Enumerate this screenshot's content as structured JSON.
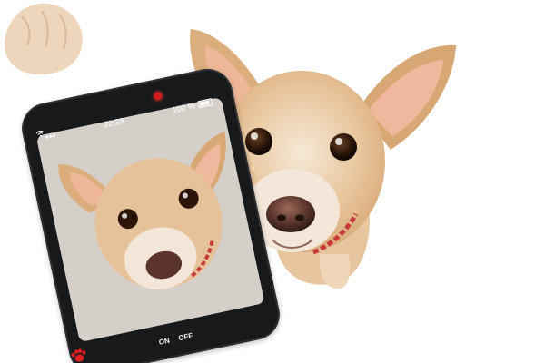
{
  "photo": {
    "subject": "dog-selfie",
    "background_color": "#ffffff",
    "fur_color": "#e0b886",
    "fur_light": "#f3e2cd",
    "ear_inner": "#f0b79b",
    "collar_color": "#c63a3a"
  },
  "phone": {
    "time": "22:29",
    "battery": "100 %",
    "on_label": "ON",
    "off_label": "OFF",
    "body_color": "#18191b",
    "camera_dot_color": "#d11b1b",
    "paw_button_color": "#e02020"
  }
}
